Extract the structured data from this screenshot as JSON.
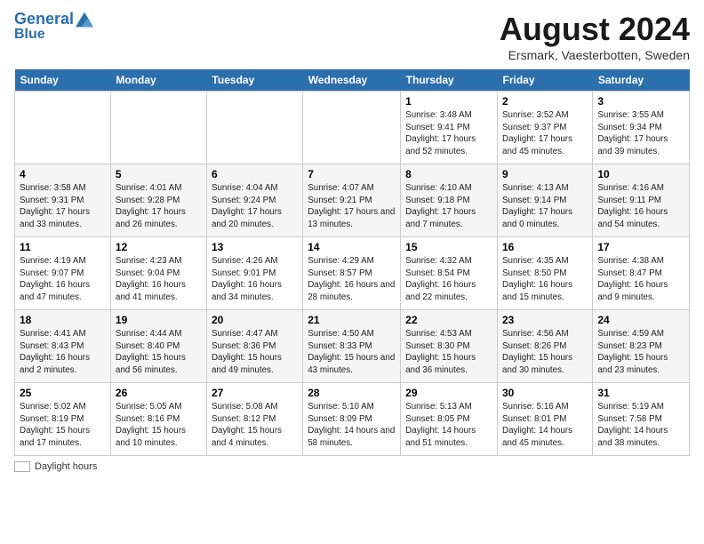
{
  "header": {
    "logo_line1": "General",
    "logo_line2": "Blue",
    "main_title": "August 2024",
    "subtitle": "Ersmark, Vaesterbotten, Sweden"
  },
  "footer": {
    "daylight_label": "Daylight hours"
  },
  "weekdays": [
    "Sunday",
    "Monday",
    "Tuesday",
    "Wednesday",
    "Thursday",
    "Friday",
    "Saturday"
  ],
  "weeks": [
    [
      {
        "day": "",
        "info": ""
      },
      {
        "day": "",
        "info": ""
      },
      {
        "day": "",
        "info": ""
      },
      {
        "day": "",
        "info": ""
      },
      {
        "day": "1",
        "info": "Sunrise: 3:48 AM\nSunset: 9:41 PM\nDaylight: 17 hours and 52 minutes."
      },
      {
        "day": "2",
        "info": "Sunrise: 3:52 AM\nSunset: 9:37 PM\nDaylight: 17 hours and 45 minutes."
      },
      {
        "day": "3",
        "info": "Sunrise: 3:55 AM\nSunset: 9:34 PM\nDaylight: 17 hours and 39 minutes."
      }
    ],
    [
      {
        "day": "4",
        "info": "Sunrise: 3:58 AM\nSunset: 9:31 PM\nDaylight: 17 hours and 33 minutes."
      },
      {
        "day": "5",
        "info": "Sunrise: 4:01 AM\nSunset: 9:28 PM\nDaylight: 17 hours and 26 minutes."
      },
      {
        "day": "6",
        "info": "Sunrise: 4:04 AM\nSunset: 9:24 PM\nDaylight: 17 hours and 20 minutes."
      },
      {
        "day": "7",
        "info": "Sunrise: 4:07 AM\nSunset: 9:21 PM\nDaylight: 17 hours and 13 minutes."
      },
      {
        "day": "8",
        "info": "Sunrise: 4:10 AM\nSunset: 9:18 PM\nDaylight: 17 hours and 7 minutes."
      },
      {
        "day": "9",
        "info": "Sunrise: 4:13 AM\nSunset: 9:14 PM\nDaylight: 17 hours and 0 minutes."
      },
      {
        "day": "10",
        "info": "Sunrise: 4:16 AM\nSunset: 9:11 PM\nDaylight: 16 hours and 54 minutes."
      }
    ],
    [
      {
        "day": "11",
        "info": "Sunrise: 4:19 AM\nSunset: 9:07 PM\nDaylight: 16 hours and 47 minutes."
      },
      {
        "day": "12",
        "info": "Sunrise: 4:23 AM\nSunset: 9:04 PM\nDaylight: 16 hours and 41 minutes."
      },
      {
        "day": "13",
        "info": "Sunrise: 4:26 AM\nSunset: 9:01 PM\nDaylight: 16 hours and 34 minutes."
      },
      {
        "day": "14",
        "info": "Sunrise: 4:29 AM\nSunset: 8:57 PM\nDaylight: 16 hours and 28 minutes."
      },
      {
        "day": "15",
        "info": "Sunrise: 4:32 AM\nSunset: 8:54 PM\nDaylight: 16 hours and 22 minutes."
      },
      {
        "day": "16",
        "info": "Sunrise: 4:35 AM\nSunset: 8:50 PM\nDaylight: 16 hours and 15 minutes."
      },
      {
        "day": "17",
        "info": "Sunrise: 4:38 AM\nSunset: 8:47 PM\nDaylight: 16 hours and 9 minutes."
      }
    ],
    [
      {
        "day": "18",
        "info": "Sunrise: 4:41 AM\nSunset: 8:43 PM\nDaylight: 16 hours and 2 minutes."
      },
      {
        "day": "19",
        "info": "Sunrise: 4:44 AM\nSunset: 8:40 PM\nDaylight: 15 hours and 56 minutes."
      },
      {
        "day": "20",
        "info": "Sunrise: 4:47 AM\nSunset: 8:36 PM\nDaylight: 15 hours and 49 minutes."
      },
      {
        "day": "21",
        "info": "Sunrise: 4:50 AM\nSunset: 8:33 PM\nDaylight: 15 hours and 43 minutes."
      },
      {
        "day": "22",
        "info": "Sunrise: 4:53 AM\nSunset: 8:30 PM\nDaylight: 15 hours and 36 minutes."
      },
      {
        "day": "23",
        "info": "Sunrise: 4:56 AM\nSunset: 8:26 PM\nDaylight: 15 hours and 30 minutes."
      },
      {
        "day": "24",
        "info": "Sunrise: 4:59 AM\nSunset: 8:23 PM\nDaylight: 15 hours and 23 minutes."
      }
    ],
    [
      {
        "day": "25",
        "info": "Sunrise: 5:02 AM\nSunset: 8:19 PM\nDaylight: 15 hours and 17 minutes."
      },
      {
        "day": "26",
        "info": "Sunrise: 5:05 AM\nSunset: 8:16 PM\nDaylight: 15 hours and 10 minutes."
      },
      {
        "day": "27",
        "info": "Sunrise: 5:08 AM\nSunset: 8:12 PM\nDaylight: 15 hours and 4 minutes."
      },
      {
        "day": "28",
        "info": "Sunrise: 5:10 AM\nSunset: 8:09 PM\nDaylight: 14 hours and 58 minutes."
      },
      {
        "day": "29",
        "info": "Sunrise: 5:13 AM\nSunset: 8:05 PM\nDaylight: 14 hours and 51 minutes."
      },
      {
        "day": "30",
        "info": "Sunrise: 5:16 AM\nSunset: 8:01 PM\nDaylight: 14 hours and 45 minutes."
      },
      {
        "day": "31",
        "info": "Sunrise: 5:19 AM\nSunset: 7:58 PM\nDaylight: 14 hours and 38 minutes."
      }
    ]
  ]
}
